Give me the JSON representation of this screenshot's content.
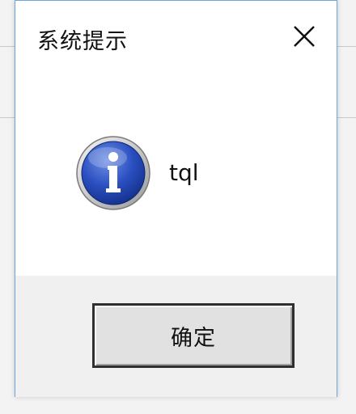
{
  "dialog": {
    "title": "系统提示",
    "message": "tql",
    "icon": "info-icon",
    "ok_label": "确定"
  },
  "colors": {
    "border": "#6aa6dc",
    "footer_bg": "#f0f0f0",
    "button_bg": "#e1e1e1",
    "icon_blue": "#1f3fa8"
  }
}
